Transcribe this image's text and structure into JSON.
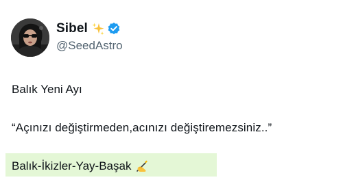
{
  "author": {
    "display_name": "Sibel",
    "handle": "@SeedAstro",
    "icons": [
      "sparkles-icon",
      "verified-badge-icon"
    ],
    "verified_color": "#1d9bf0"
  },
  "tweet": {
    "lines": [
      "Balık Yeni Ayı",
      "“Açınızı değiştirmeden,acınızı değiştiremezsiniz..”",
      "Balık-İkizler-Yay-Başak"
    ],
    "trailing_emoji_icon": "writing-hand-icon",
    "highlight_color": "#e4f7d6"
  }
}
